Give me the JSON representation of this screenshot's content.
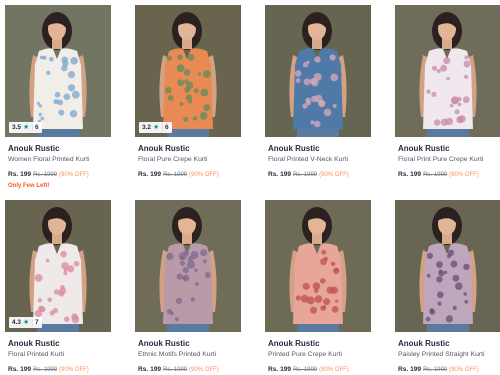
{
  "products": [
    {
      "brand": "Anouk Rustic",
      "name": "Women Floral Printed Kurti",
      "price": "Rs. 199",
      "mrp": "Rs. 1999",
      "discount": "(90% OFF)",
      "rating": "3.5",
      "rating_count": "6",
      "badge": "Only Few Left!",
      "bg": "#7b7d6a",
      "top_color": "#f1eee9",
      "accent": "#7aa5cf"
    },
    {
      "brand": "Anouk Rustic",
      "name": "Floral Pure Crepe Kurti",
      "price": "Rs. 199",
      "mrp": "Rs. 1999",
      "discount": "(90% OFF)",
      "rating": "3.2",
      "rating_count": "6",
      "bg": "#6f6b52",
      "top_color": "#e98a55",
      "accent": "#5d8c5a"
    },
    {
      "brand": "Anouk Rustic",
      "name": "Floral Printed V-Neck Kurti",
      "price": "Rs. 199",
      "mrp": "Rs. 1999",
      "discount": "(90% OFF)",
      "bg": "#6d6c57",
      "top_color": "#4f7aa8",
      "accent": "#d9a9b9"
    },
    {
      "brand": "Anouk Rustic",
      "name": "Floral Print Pure Crepe Kurti",
      "price": "Rs. 199",
      "mrp": "Rs. 1999",
      "discount": "(90% OFF)",
      "bg": "#76745f",
      "top_color": "#f0e8ee",
      "accent": "#c98aa8"
    },
    {
      "brand": "Anouk Rustic",
      "name": "Floral Printed Kurti",
      "price": "Rs. 199",
      "mrp": "Rs. 1999",
      "discount": "(90% OFF)",
      "rating": "4.3",
      "rating_count": "7",
      "bg": "#6e6c56",
      "top_color": "#efe9ea",
      "accent": "#d98a9a"
    },
    {
      "brand": "Anouk Rustic",
      "name": "Ethnic Motifs Printed Kurti",
      "price": "Rs. 199",
      "mrp": "Rs. 1999",
      "discount": "(90% OFF)",
      "bg": "#76735e",
      "top_color": "#b99aa8",
      "accent": "#7c6a8f"
    },
    {
      "brand": "Anouk Rustic",
      "name": "Printed Pure Crepe Kurti",
      "price": "Rs. 199",
      "mrp": "Rs. 1999",
      "discount": "(90% OFF)",
      "bg": "#74725c",
      "top_color": "#e8a59a",
      "accent": "#c0524d"
    },
    {
      "brand": "Anouk Rustic",
      "name": "Paisley Printed Straight Kurti",
      "price": "Rs. 199",
      "mrp": "Rs. 1999",
      "discount": "(90% OFF)",
      "bg": "#6f6d58",
      "top_color": "#bea6bd",
      "accent": "#6a4c74"
    }
  ]
}
